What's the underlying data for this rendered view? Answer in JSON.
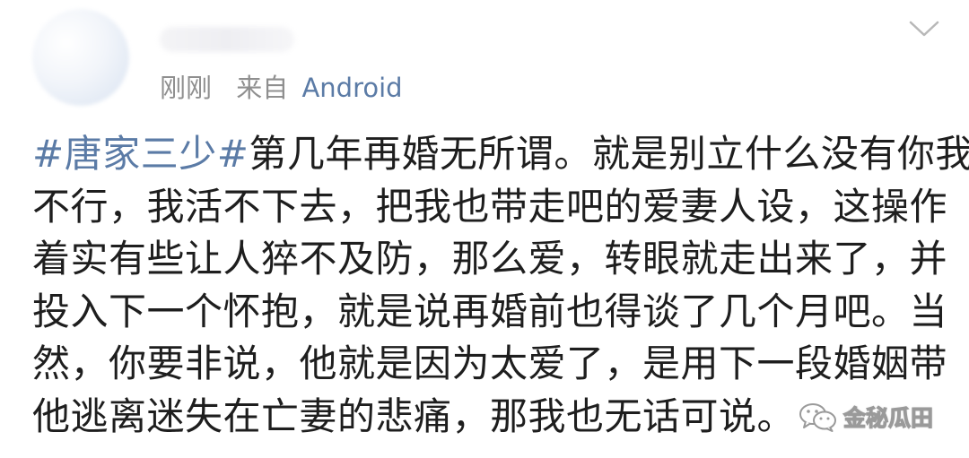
{
  "post": {
    "time": "刚刚",
    "source_prefix": "来自",
    "source_client": "Android",
    "hashtag": "#唐家三少#",
    "body_lines": [
      "第几年再婚无所谓。就是别立什么没有你我",
      "不行，我活不下去，把我也带走吧的爱妻人设，这操作",
      "着实有些让人猝不及防，那么爱，转眼就走出来了，并",
      "投入下一个怀抱，就是说再婚前也得谈了几个月吧。当",
      "然，你要非说，他就是因为太爱了，是用下一段婚姻带",
      "他逃离迷失在亡妻的悲痛，那我也无话可说。"
    ]
  },
  "watermark": {
    "text": "金秘瓜田",
    "icon": "wechat-icon"
  },
  "icons": {
    "menu": "chevron-down-icon"
  },
  "colors": {
    "link": "#5b7ba6",
    "meta": "#8f8f8f",
    "text": "#1e1e1e"
  }
}
